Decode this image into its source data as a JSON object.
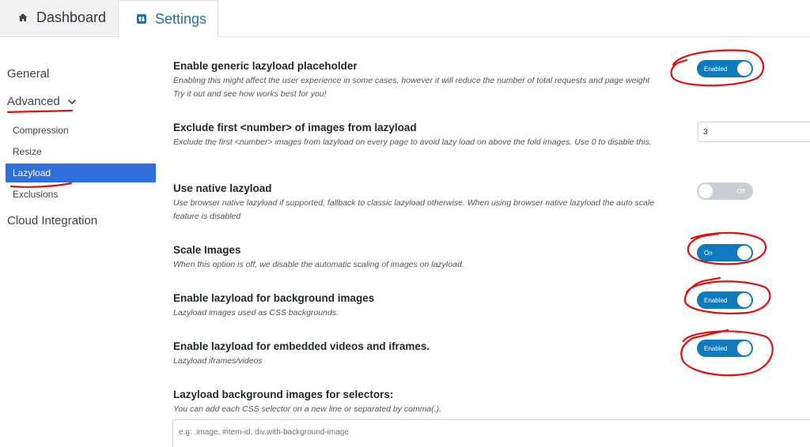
{
  "tabs": {
    "dashboard": "Dashboard",
    "settings": "Settings"
  },
  "sidebar": {
    "general": "General",
    "advanced": "Advanced",
    "sub_items": [
      "Compression",
      "Resize",
      "Lazyload",
      "Exclusions"
    ],
    "active_item": "Lazyload",
    "cloud": "Cloud Integration"
  },
  "settings": {
    "placeholder": {
      "title": "Enable generic lazyload placeholder",
      "desc_line1": "Enabling this might affect the user experience in some cases, however it will reduce the number of total requests and page weight",
      "desc_line2": "Try it out and see how works best for you!",
      "toggle": "Enabled",
      "state": "on"
    },
    "exclude_first": {
      "title": "Exclude first <number> of images from lazyload",
      "desc": "Exclude the first <number> images from lazyload on every page to avoid lazy load on above the fold images. Use 0 to disable this.",
      "value": "3"
    },
    "native": {
      "title": "Use native lazyload",
      "desc": "Use browser native lazyload if supported, fallback to classic lazyload otherwise. When using browser native lazyload the auto scale feature is disabled",
      "toggle": "Off",
      "state": "off"
    },
    "scale": {
      "title": "Scale Images",
      "desc": "When this option is off, we disable the automatic scaling of images on lazyload.",
      "toggle": "On",
      "state": "on"
    },
    "background": {
      "title": "Enable lazyload for background images",
      "desc": "Lazyload images used as CSS backgrounds.",
      "toggle": "Enabled",
      "state": "on"
    },
    "iframes": {
      "title": "Enable lazyload for embedded videos and iframes.",
      "desc": "Lazyload iframes/videos",
      "toggle": "Enabled",
      "state": "on"
    },
    "selectors": {
      "title": "Lazyload background images for selectors:",
      "desc": "You can add each CSS selector on a new line or separated by comma(,).",
      "placeholder": "e.g: .image, #item-id, div.with-background-image"
    }
  },
  "colors": {
    "accent": "#0e7bbf",
    "active_nav": "#2f6fdc",
    "annotation": "#e01010"
  },
  "icons": {
    "dashboard": "home-icon",
    "settings": "settings-icon",
    "advanced": "chevron-down-icon"
  }
}
